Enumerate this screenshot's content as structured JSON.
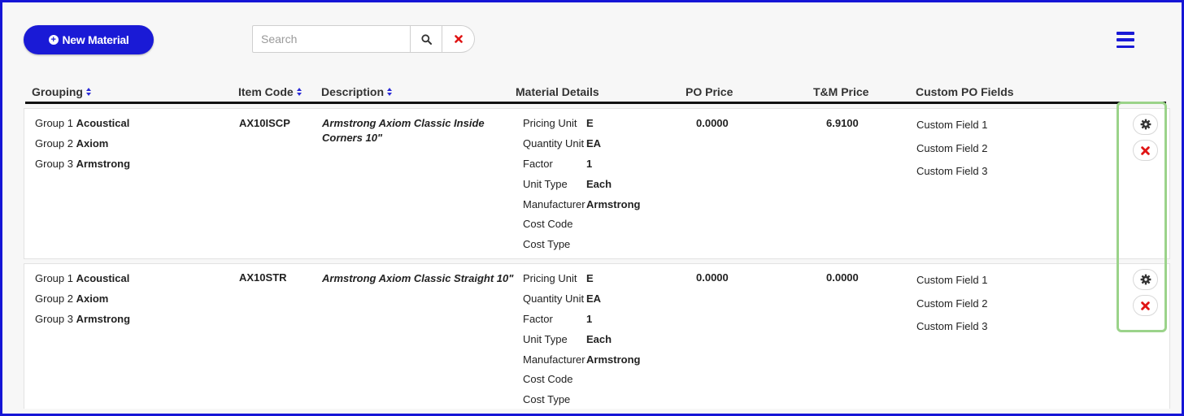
{
  "toolbar": {
    "new_material_label": "New Material",
    "search_placeholder": "Search",
    "search_value": ""
  },
  "columns": {
    "grouping": "Grouping",
    "item_code": "Item Code",
    "description": "Description",
    "material_details": "Material Details",
    "po_price": "PO Price",
    "tm_price": "T&M Price",
    "custom_po_fields": "Custom PO Fields"
  },
  "rows": [
    {
      "group1_label": "Group 1",
      "group1_value": "Acoustical",
      "group2_label": "Group 2",
      "group2_value": "Axiom",
      "group3_label": "Group 3",
      "group3_value": "Armstrong",
      "item_code": "AX10ISCP",
      "description": "Armstrong Axiom Classic Inside Corners 10\"",
      "details": {
        "pricing_unit_label": "Pricing Unit",
        "pricing_unit": "E",
        "quantity_unit_label": "Quantity Unit",
        "quantity_unit": "EA",
        "factor_label": "Factor",
        "factor": "1",
        "unit_type_label": "Unit Type",
        "unit_type": "Each",
        "manufacturer_label": "Manufacturer",
        "manufacturer": "Armstrong",
        "cost_code_label": "Cost Code",
        "cost_code": "",
        "cost_type_label": "Cost Type",
        "cost_type": ""
      },
      "po_price": "0.0000",
      "tm_price": "6.9100",
      "custom_fields": [
        "Custom Field 1",
        "Custom Field 2",
        "Custom Field 3"
      ]
    },
    {
      "group1_label": "Group 1",
      "group1_value": "Acoustical",
      "group2_label": "Group 2",
      "group2_value": "Axiom",
      "group3_label": "Group 3",
      "group3_value": "Armstrong",
      "item_code": "AX10STR",
      "description": "Armstrong Axiom Classic Straight 10\"",
      "details": {
        "pricing_unit_label": "Pricing Unit",
        "pricing_unit": "E",
        "quantity_unit_label": "Quantity Unit",
        "quantity_unit": "EA",
        "factor_label": "Factor",
        "factor": "1",
        "unit_type_label": "Unit Type",
        "unit_type": "Each",
        "manufacturer_label": "Manufacturer",
        "manufacturer": "Armstrong",
        "cost_code_label": "Cost Code",
        "cost_code": "",
        "cost_type_label": "Cost Type",
        "cost_type": ""
      },
      "po_price": "0.0000",
      "tm_price": "0.0000",
      "custom_fields": [
        "Custom Field 1",
        "Custom Field 2",
        "Custom Field 3"
      ]
    }
  ],
  "icons": {
    "new": "plus-circle-icon",
    "search": "search-icon",
    "clear": "close-icon",
    "menu": "hamburger-menu-icon",
    "settings": "gear-icon",
    "delete": "close-icon",
    "sort": "sort-icon"
  },
  "colors": {
    "accent": "#1a1ad6",
    "danger": "#e01515",
    "highlight": "#9bd38a",
    "frame": "#1515d6"
  }
}
